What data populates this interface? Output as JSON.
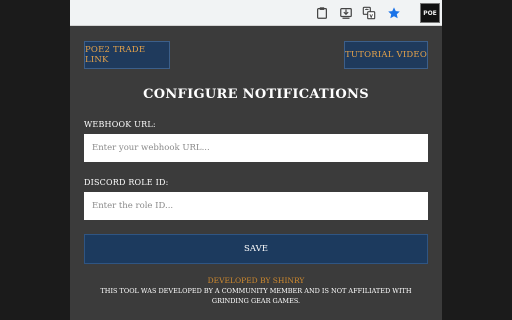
{
  "browser": {
    "avatar_label": "POE"
  },
  "popup": {
    "trade_link_label": "POE2 TRADE LINK",
    "tutorial_label": "TUTORIAL VIDEO",
    "title": "CONFIGURE NOTIFICATIONS",
    "webhook": {
      "label": "WEBHOOK URL:",
      "placeholder": "Enter your webhook URL...",
      "value": ""
    },
    "role": {
      "label": "DISCORD ROLE ID:",
      "placeholder": "Enter the role ID...",
      "value": ""
    },
    "save_label": "SAVE",
    "developer_credit": "DEVELOPED BY SHINRY",
    "disclaimer": "THIS TOOL WAS DEVELOPED BY A COMMUNITY MEMBER AND IS NOT AFFILIATED WITH GRINDING GEAR GAMES."
  },
  "colors": {
    "panel_bg": "#3b3b3b",
    "button_bg": "#1f3a5c",
    "accent_gold": "#e4a24a",
    "credit_orange": "#d08a2e",
    "star_blue": "#1a73e8"
  },
  "icons": [
    "clipboard-icon",
    "download-icon",
    "translate-icon",
    "star-icon",
    "extension-avatar-icon"
  ]
}
